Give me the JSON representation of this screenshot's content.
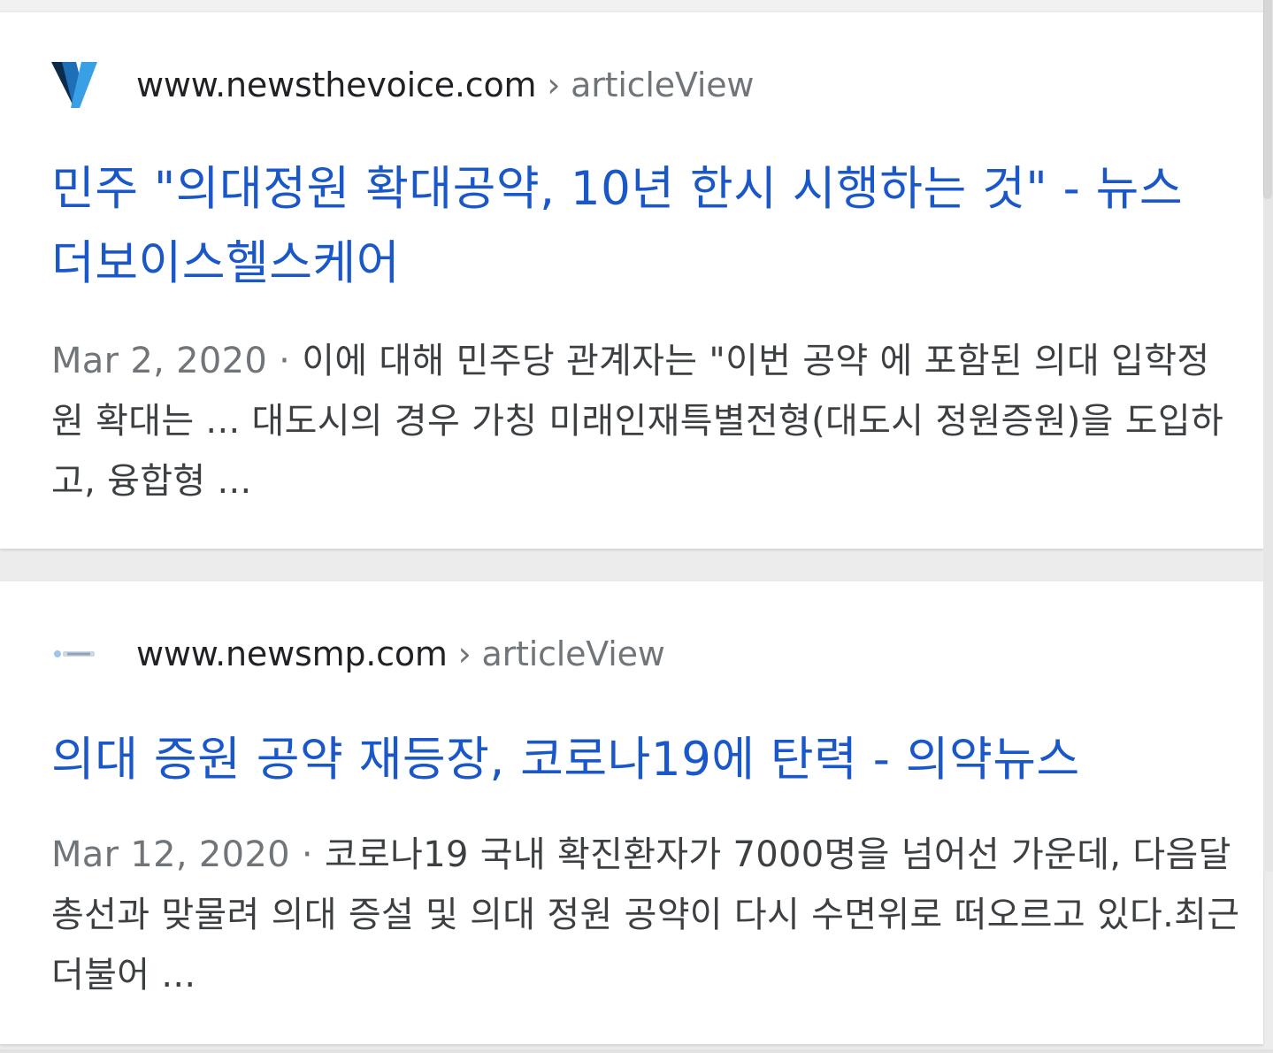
{
  "results": [
    {
      "site_icon": "newsthevoice-v-logo-icon",
      "domain": "www.newsthevoice.com",
      "separator": " › ",
      "path": "articleView",
      "title": "민주 \"의대정원 확대공약, 10년 한시 시행하는 것\" - 뉴스더보이스헬스케어",
      "date": "Mar 2, 2020",
      "date_separator": " · ",
      "snippet": "이에 대해 민주당 관계자는 \"이번 공약 에 포함된 의대 입학정원 확대는 ... 대도시의 경우 가칭 미래인재특별전형(대도시 정원증원)을 도입하고, 융합형 ..."
    },
    {
      "site_icon": "newsmp-logo-icon",
      "domain": "www.newsmp.com",
      "separator": " › ",
      "path": "articleView",
      "title": "의대 증원 공약 재등장, 코로나19에 탄력 - 의약뉴스",
      "date": "Mar 12, 2020",
      "date_separator": " · ",
      "snippet": "코로나19 국내 확진환자가 7000명을 넘어선 가운데, 다음달 총선과 맞물려 의대 증설 및 의대 정원 공약이 다시 수면위로 떠오르고 있다.최근 더불어 ..."
    }
  ],
  "colors": {
    "title_link": "#1a57c8",
    "domain_text": "#202124",
    "secondary_text": "#70757a",
    "snippet_text": "#3c4043",
    "logo_blue": "#1f7fd0",
    "logo_navy": "#0c2b4a"
  }
}
